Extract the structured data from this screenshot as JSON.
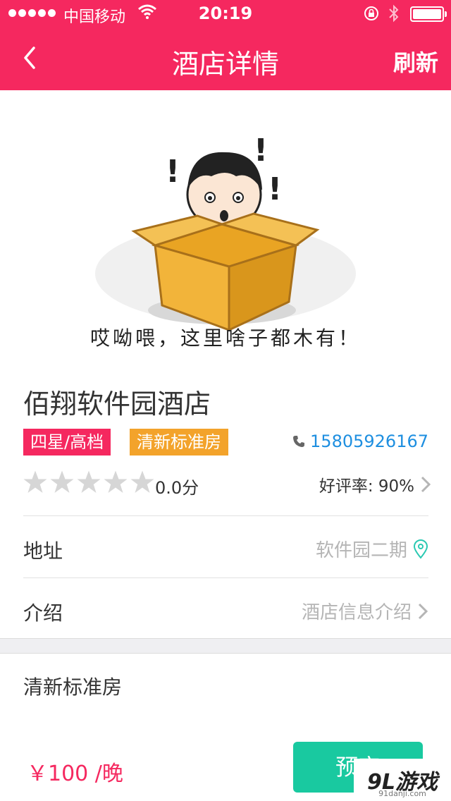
{
  "status_bar": {
    "carrier": "中国移动",
    "time": "20:19"
  },
  "nav": {
    "title": "酒店详情",
    "refresh_label": "刷新",
    "back_icon": "chevron-left-icon"
  },
  "empty_state": {
    "caption": "哎呦喂，这里啥子都木有！",
    "illustration": "boy-in-box-illustration"
  },
  "hotel": {
    "name": "佰翔软件园酒店",
    "star_tag": "四星/高档",
    "room_tag": "清新标准房",
    "phone": "15805926167",
    "rating": 0,
    "rating_max": 5,
    "score_text": "0.0分",
    "good_rate": "好评率: 90%"
  },
  "rows": {
    "address_label": "地址",
    "address_value": "软件园二期",
    "intro_label": "介绍",
    "intro_value": "酒店信息介绍"
  },
  "room": {
    "title": "清新标准房",
    "price": "￥100 /晚",
    "book_label": "预定"
  },
  "watermark": {
    "logo": "9L游戏",
    "sub": "91danji.com"
  },
  "colors": {
    "accent": "#f5285f",
    "tag_orange": "#f3a32b",
    "link_blue": "#1e8fe0",
    "book_green": "#19c9a0",
    "location_teal": "#2ac9b2"
  }
}
